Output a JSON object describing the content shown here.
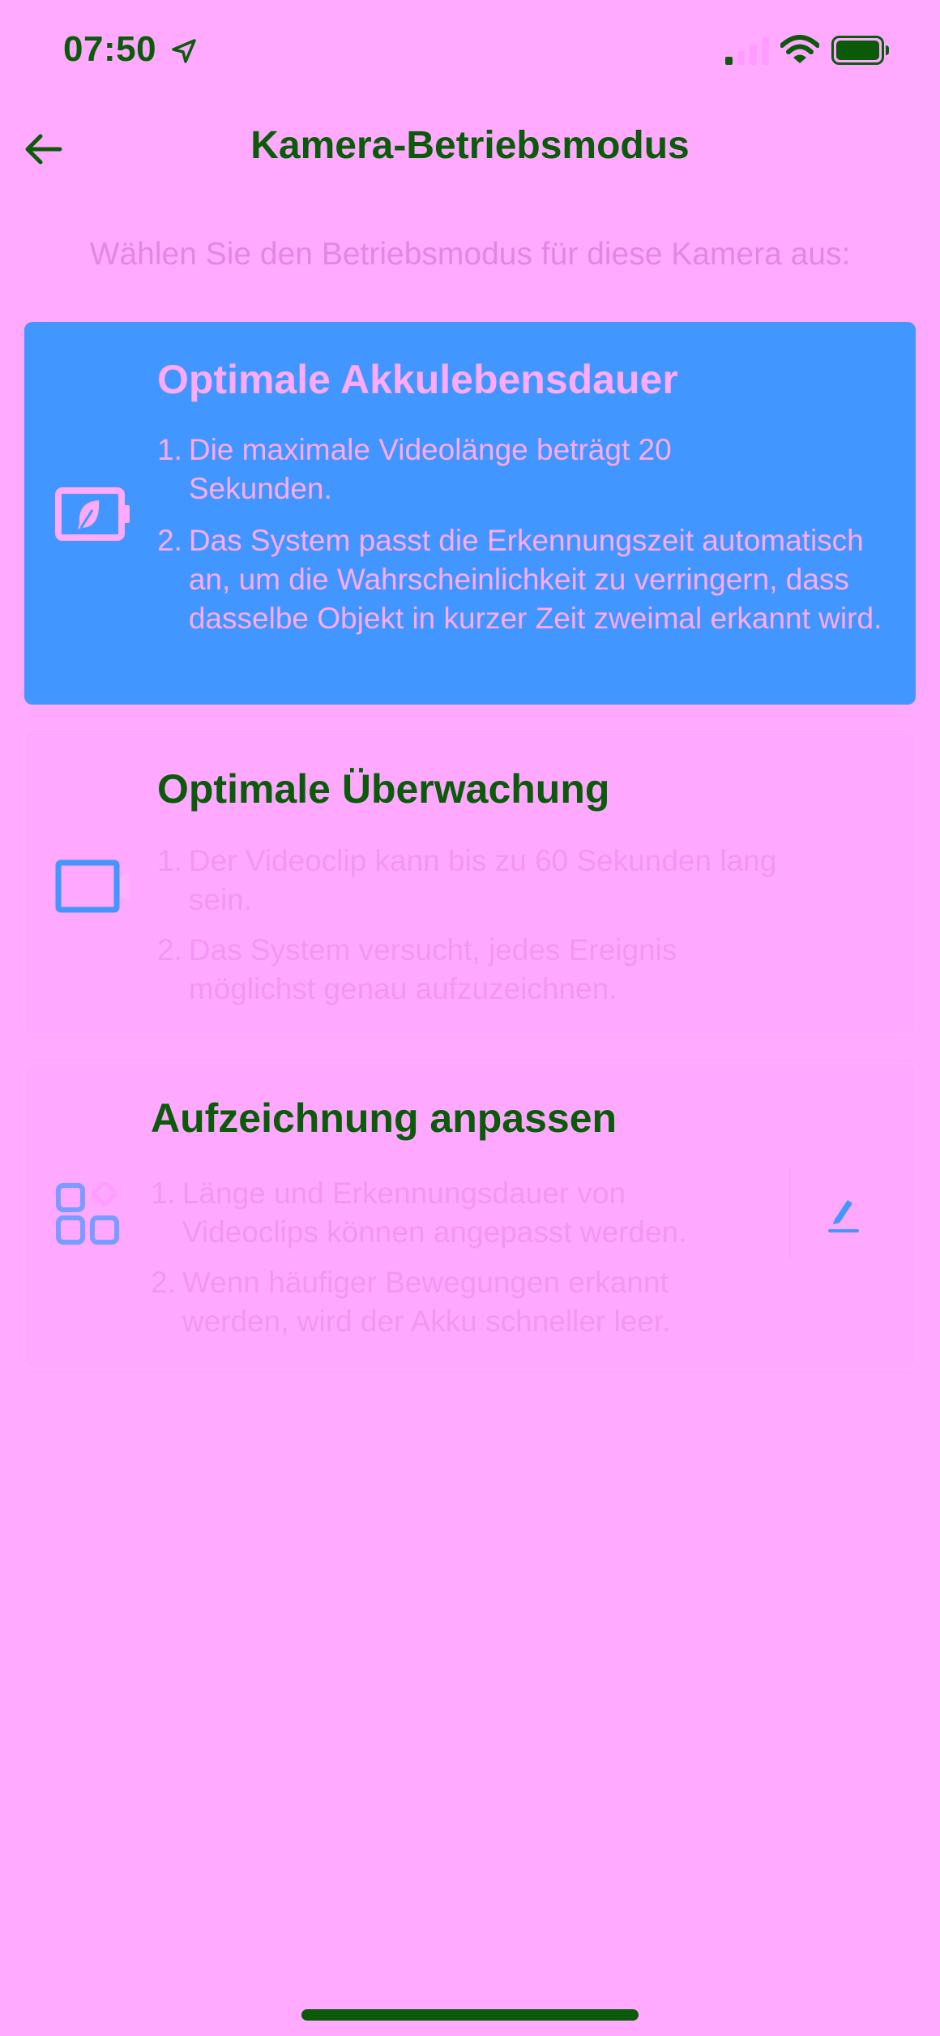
{
  "status_bar": {
    "time": "07:50",
    "location_icon": "location-arrow-icon",
    "signal_icon": "cellular-signal-icon",
    "wifi_icon": "wifi-icon",
    "battery_icon": "battery-icon"
  },
  "header": {
    "back_icon": "arrow-left-icon",
    "title": "Kamera-Betriebsmodus"
  },
  "subtitle": "Wählen Sie den Betriebsmodus für diese Kamera aus:",
  "modes": [
    {
      "title": "Optimale Akkulebensdauer",
      "icon": "battery-leaf-icon",
      "selected": true,
      "items": [
        {
          "num": "1.",
          "text": "Die maximale Videolänge beträgt 20 Sekunden."
        },
        {
          "num": "2.",
          "text": "Das System passt die Erkennungszeit automatisch an, um die Wahrscheinlichkeit zu verringern, dass dasselbe Objekt in kurzer Zeit zweimal erkannt wird."
        }
      ]
    },
    {
      "title": "Optimale Überwachung",
      "icon": "video-camera-icon",
      "selected": false,
      "items": [
        {
          "num": "1.",
          "text": "Der Videoclip kann bis zu 60 Sekunden lang sein."
        },
        {
          "num": "2.",
          "text": "Das System versucht, jedes Ereignis möglichst genau aufzuzeichnen."
        }
      ]
    },
    {
      "title": "Aufzeichnung anpassen",
      "icon": "customize-grid-icon",
      "edit_icon": "pencil-icon",
      "selected": false,
      "items": [
        {
          "num": "1.",
          "text": "Länge und Erkennungsdauer von Videoclips können angepasst werden."
        },
        {
          "num": "2.",
          "text": "Wenn häufiger Bewegungen erkannt werden, wird der Akku schneller leer."
        }
      ]
    }
  ],
  "colors": {
    "background": "#ffaaff",
    "selected_card": "#4196ff",
    "title_green": "#0a5a0a",
    "muted_text": "#f396f3",
    "icon_blue": "#4196ff"
  }
}
